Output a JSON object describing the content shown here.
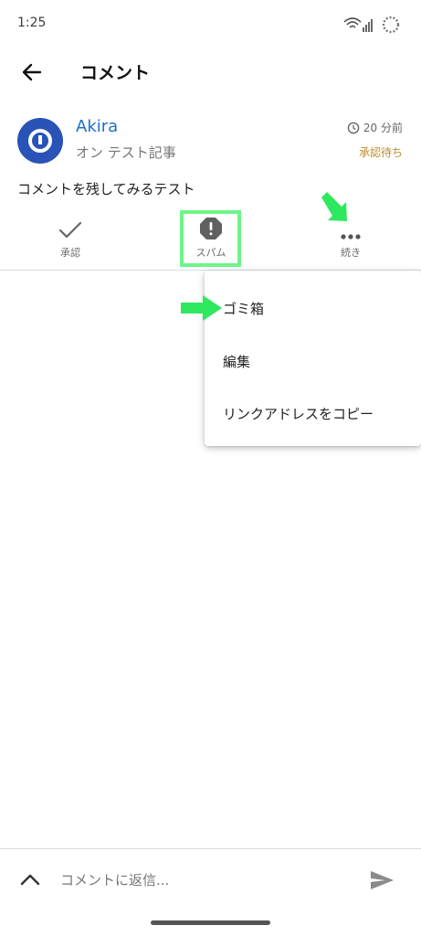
{
  "status_bar": {
    "time": "1:25"
  },
  "app_bar": {
    "title": "コメント"
  },
  "comment": {
    "author": "Akira",
    "post_ref": "オン テスト記事",
    "time_ago": "20 分前",
    "status": "承認待ち",
    "body": "コメントを残してみるテスト"
  },
  "actions": {
    "approve_label": "承認",
    "spam_label": "スパム",
    "more_label": "続き"
  },
  "menu": {
    "items": [
      {
        "label": "ゴミ箱"
      },
      {
        "label": "編集"
      },
      {
        "label": "リンクアドレスをコピー"
      }
    ]
  },
  "reply": {
    "placeholder": "コメントに返信..."
  },
  "colors": {
    "accent_blue": "#1d6fc4",
    "avatar_blue": "#2953b6",
    "pending_gold": "#c28a27",
    "highlight_green": "#6ef58a"
  },
  "icons": [
    "wifi-icon",
    "signal-icon",
    "loading-spinner-icon",
    "back-arrow-icon",
    "clock-icon",
    "check-icon",
    "spam-icon",
    "more-icon",
    "chevron-up-icon",
    "send-icon"
  ]
}
